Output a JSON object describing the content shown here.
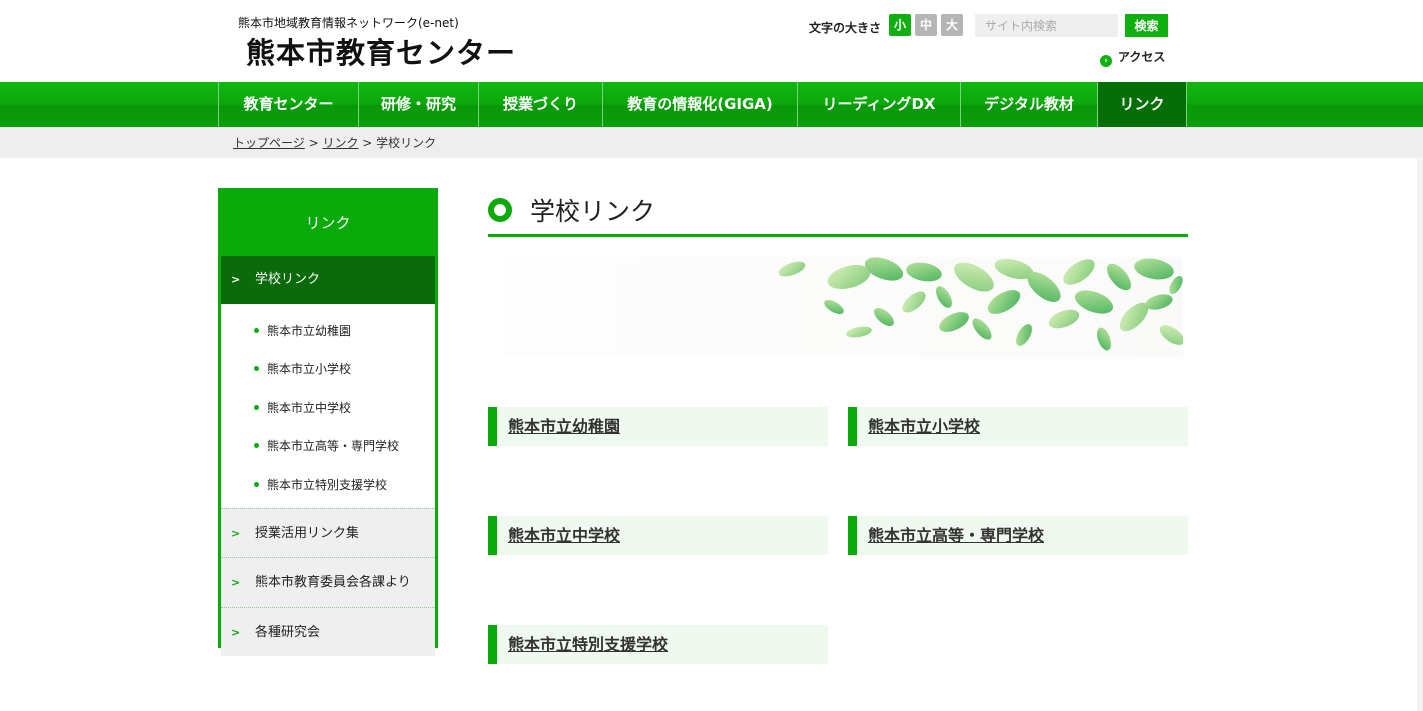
{
  "header": {
    "subtitle": "熊本市地域教育情報ネットワーク(e-net)",
    "title": "熊本市教育センター",
    "font_size_label": "文字の大きさ",
    "font_sizes": [
      "小",
      "中",
      "大"
    ],
    "search_placeholder": "サイト内検索",
    "search_button": "検索",
    "access_label": "アクセス"
  },
  "nav": {
    "items": [
      "教育センター",
      "研修・研究",
      "授業づくり",
      "教育の情報化(GIGA)",
      "リーディングDX",
      "デジタル教材",
      "リンク"
    ],
    "active_index": 6
  },
  "breadcrumb": {
    "top": "トップページ",
    "sep": " > ",
    "link": "リンク",
    "current": "学校リンク"
  },
  "sidebar": {
    "heading": "リンク",
    "current": "学校リンク",
    "sub_items": [
      "熊本市立幼稚園",
      "熊本市立小学校",
      "熊本市立中学校",
      "熊本市立高等・専門学校",
      "熊本市立特別支援学校"
    ],
    "other_items": [
      "授業活用リンク集",
      "熊本市教育委員会各課より",
      "各種研究会"
    ]
  },
  "main": {
    "heading": "学校リンク",
    "links": [
      "熊本市立幼稚園",
      "熊本市立小学校",
      "熊本市立中学校",
      "熊本市立高等・専門学校",
      "熊本市立特別支援学校"
    ]
  },
  "colors": {
    "accent": "#0aaa0a",
    "nav_active": "#066e06",
    "sidebar_current": "#0b6b0b",
    "link_box_bg": "#f0f9ef"
  }
}
